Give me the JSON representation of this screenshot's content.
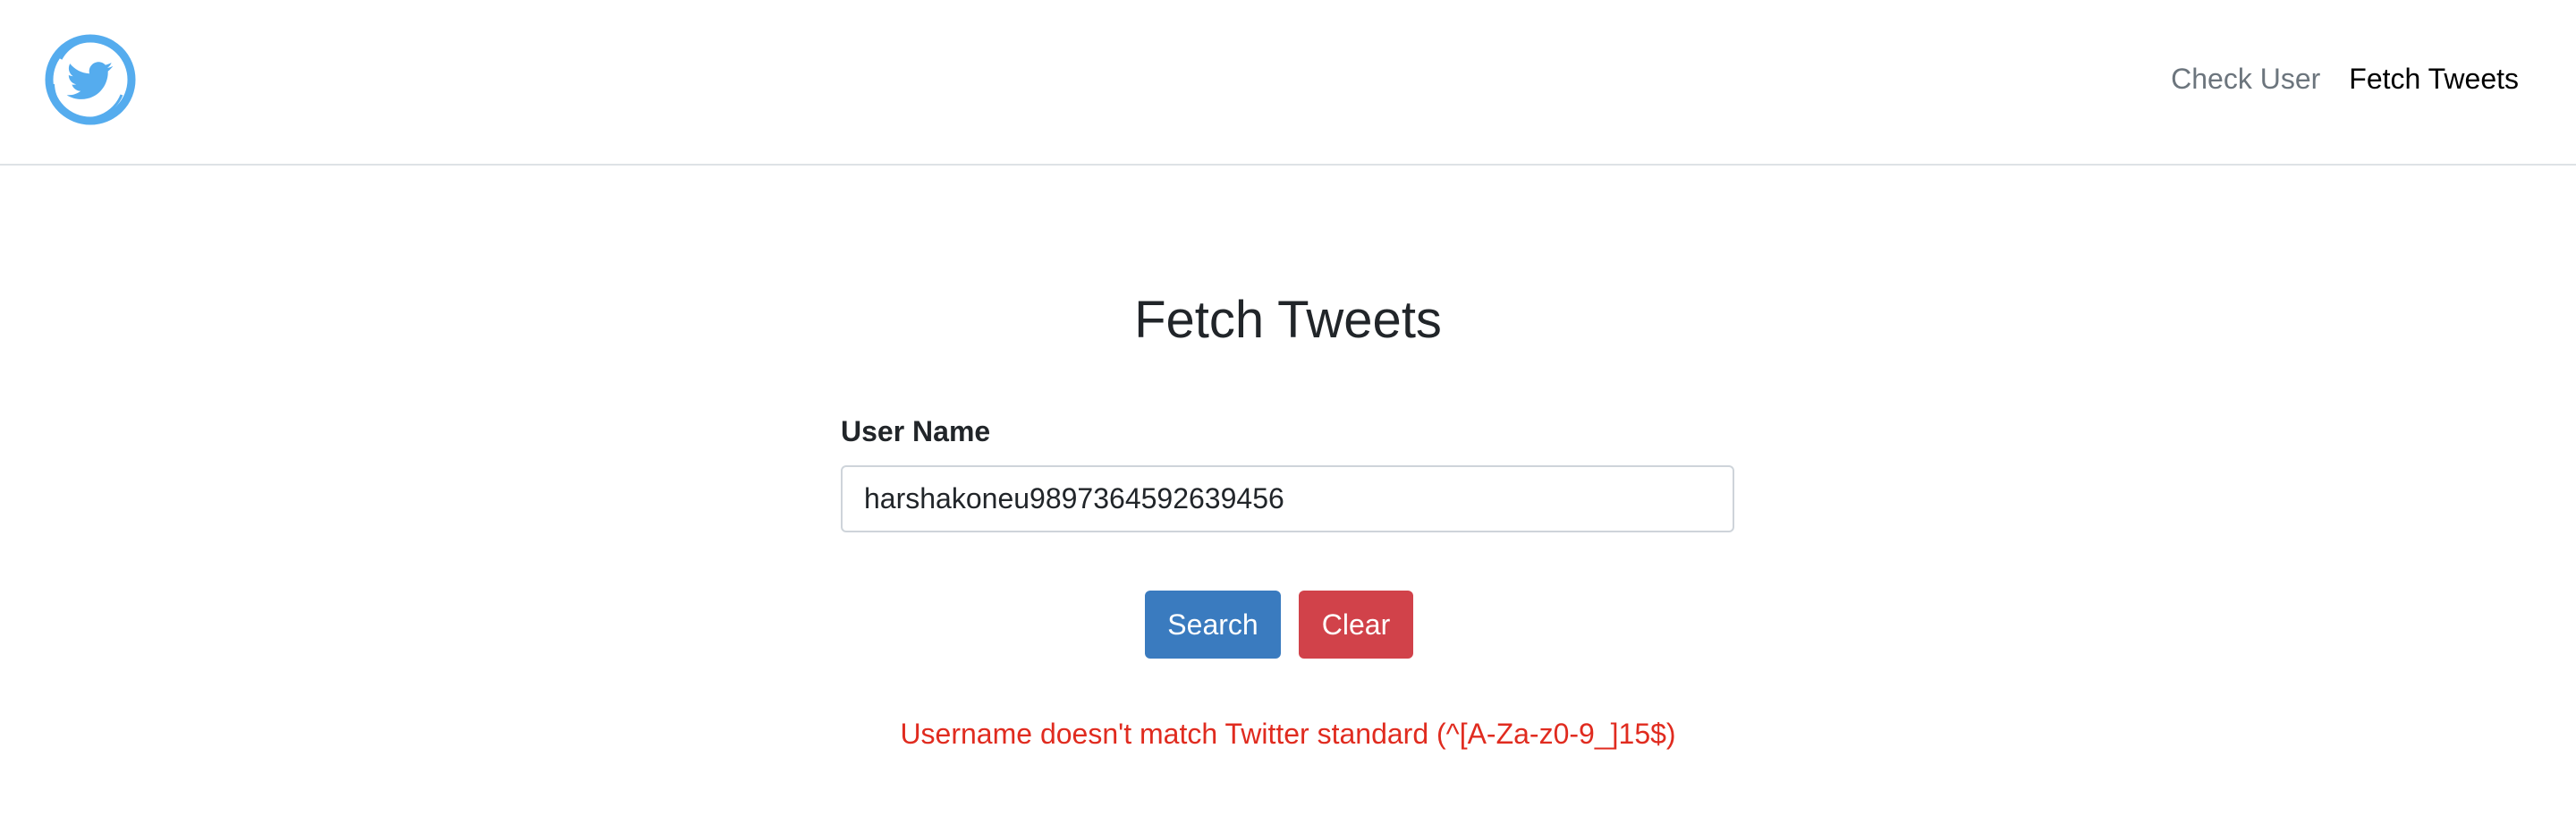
{
  "navbar": {
    "logo_icon": "twitter-bird-logo",
    "links": [
      {
        "label": "Check User",
        "state": "inactive"
      },
      {
        "label": "Fetch Tweets",
        "state": "active"
      }
    ]
  },
  "main": {
    "title": "Fetch Tweets",
    "username_label": "User Name",
    "username_value": "harshakoneu9897364592639456",
    "search_label": "Search",
    "clear_label": "Clear",
    "error_message": "Username doesn't match Twitter standard (^[A-Za-z0-9_]15$)"
  },
  "colors": {
    "brand_blue": "#55acee",
    "search_button": "#3a7bbf",
    "clear_button": "#d1424a",
    "error_text": "#e02b1f"
  }
}
